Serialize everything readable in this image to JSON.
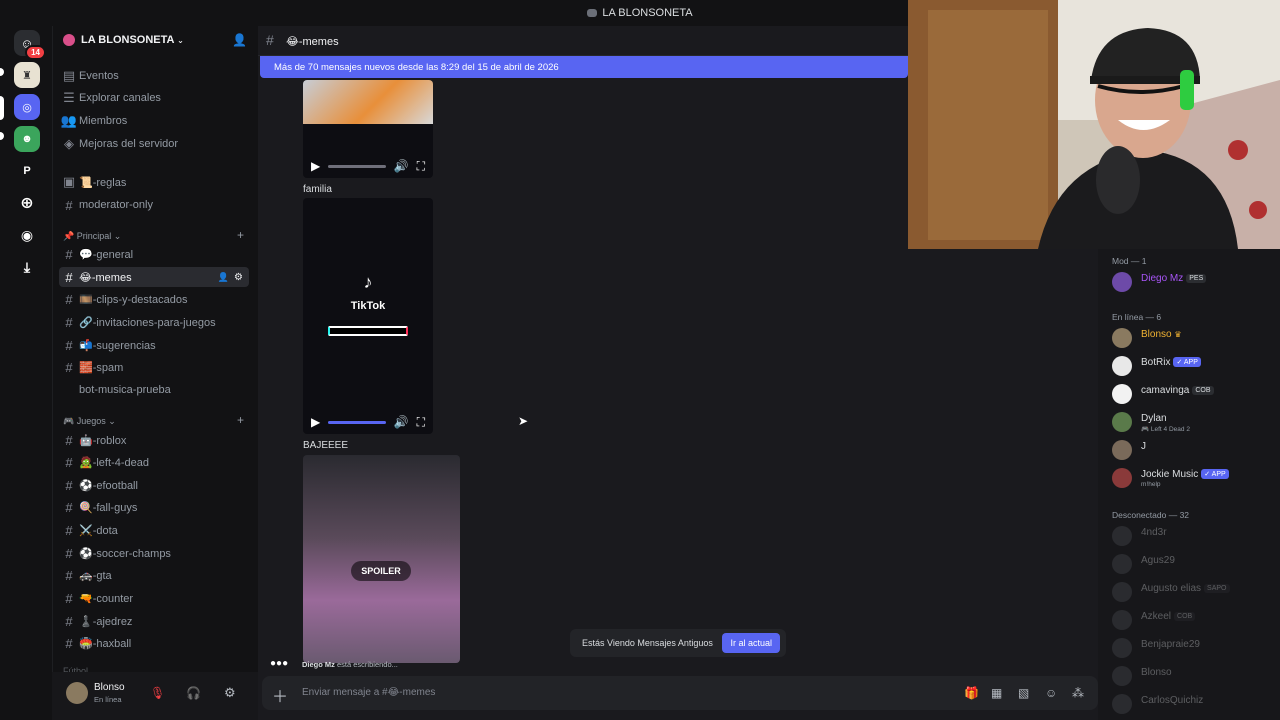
{
  "window": {
    "title": "LA BLONSONETA"
  },
  "rail": {
    "dm_badge": "14",
    "server_letter": "P"
  },
  "server": {
    "name": "LA BLONSONETA"
  },
  "sidebar": {
    "top_items": [
      {
        "label": "Eventos",
        "icon": "calendar-icon"
      },
      {
        "label": "Explorar canales",
        "icon": "list-icon"
      },
      {
        "label": "Miembros",
        "icon": "members-icon"
      },
      {
        "label": "Mejoras del servidor",
        "icon": "boost-icon"
      }
    ],
    "channels_top": [
      {
        "label": "📜-reglas",
        "icon": "book-icon"
      },
      {
        "label": "moderator-only",
        "icon": "hash-icon"
      }
    ],
    "cat_principal": "Principal",
    "channels_principal": [
      "💬-general",
      "😂-memes",
      "🎞️-clips-y-destacados",
      "🔗-invitaciones-para-juegos",
      "📬-sugerencias",
      "🧱-spam",
      "bot-musica-prueba"
    ],
    "cat_juegos": "Juegos",
    "channels_juegos": [
      "🤖-roblox",
      "🧟-left-4-dead",
      "⚽-efootball",
      "🍭-fall-guys",
      "⚔️-dota",
      "⚽-soccer-champs",
      "🚓-gta",
      "🔫-counter",
      "♟️-ajedrez",
      "🏟️-haxball"
    ],
    "cat_futbol": "Fútbol"
  },
  "user": {
    "name": "Blonso",
    "status": "En línea"
  },
  "channel": {
    "name": "😂-memes"
  },
  "new_messages_bar": "Más de 70 mensajes nuevos desde las 8:29 del 15 de abril de 2026",
  "messages": [
    {
      "text": "familia"
    },
    {
      "text": "BAJEEEE"
    }
  ],
  "tiktok": {
    "label": "TikTok"
  },
  "spoiler_label": "SPOILER",
  "old_messages": {
    "text": "Estás Viendo Mensajes Antiguos",
    "button": "Ir al actual"
  },
  "typing": {
    "user": "Diego Mz",
    "text": " está escribiendo..."
  },
  "composer": {
    "placeholder": "Enviar mensaje a #😂-memes"
  },
  "members": {
    "mod_header": "Mod — 1",
    "mod": [
      {
        "name": "Diego Mz",
        "tag": "PES"
      }
    ],
    "online_header": "En línea — 6",
    "online": [
      {
        "name": "Blonso",
        "tag": "",
        "sub": ""
      },
      {
        "name": "BotRix",
        "tag": "✓ APP",
        "sub": ""
      },
      {
        "name": "camavinga",
        "tag": "COB",
        "sub": ""
      },
      {
        "name": "Dylan",
        "tag": "",
        "sub": "🎮 Left 4 Dead 2"
      },
      {
        "name": "J",
        "tag": "",
        "sub": ""
      },
      {
        "name": "Jockie Music",
        "tag": "✓ APP",
        "sub": "m!help"
      }
    ],
    "offline_header": "Desconectado — 32",
    "offline": [
      {
        "name": "4nd3r",
        "tag": ""
      },
      {
        "name": "Agus29",
        "tag": ""
      },
      {
        "name": "Augusto elias",
        "tag": "SAPO"
      },
      {
        "name": "Azkeel",
        "tag": "COB"
      },
      {
        "name": "Benjapraie29",
        "tag": ""
      },
      {
        "name": "Blonso",
        "tag": ""
      },
      {
        "name": "CarlosQuichiz",
        "tag": ""
      }
    ]
  },
  "colors": {
    "accent": "#5865f2",
    "mod_name": "#a855f7",
    "gold_name": "#f0b232"
  }
}
